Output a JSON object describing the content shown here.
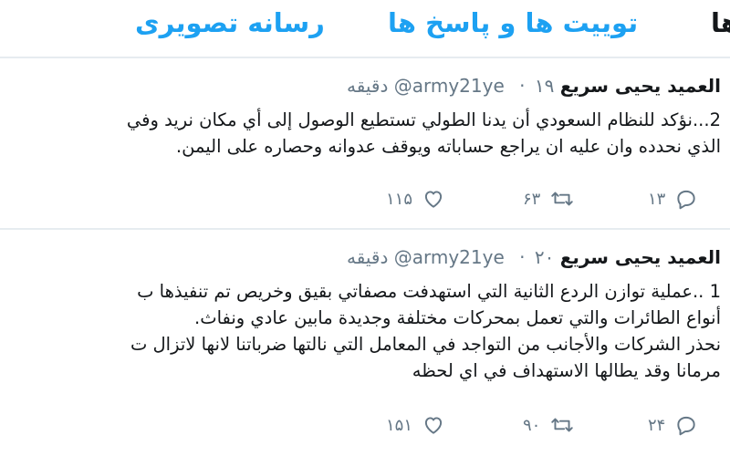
{
  "tabs": {
    "cut_label": "ها",
    "replies_label": "توییت ها و پاسخ ها",
    "media_label": "رسانه تصویری"
  },
  "tweets": [
    {
      "name": "العميد يحيى سريع",
      "handle": "@army21ye",
      "separator": "·",
      "time": "۱۹ دقیقه",
      "lines": [
        "2...نؤكد للنظام السعودي أن يدنا الطولي تستطيع الوصول إلى أي مكان نريد وفي",
        "الذي نحدده وان عليه ان يراجع حساباته ويوقف عدوانه وحصاره على اليمن."
      ],
      "reply_count": "۱۳",
      "retweet_count": "۶۳",
      "like_count": "۱۱۵"
    },
    {
      "name": "العميد يحيى سريع",
      "handle": "@army21ye",
      "separator": "·",
      "time": "۲۰ دقیقه",
      "lines": [
        "1 ..عملية توازن الردع الثانية التي استهدفت مصفاتي بقيق وخريص  تم تنفيذها ب",
        "أنواع الطائرات والتي تعمل بمحركات مختلفة وجديدة مابين عادي ونفاث.",
        "نحذر  الشركات والأجانب من التواجد في المعامل التي نالتها ضرباتنا لانها لاتزال ت",
        "مرمانا وقد يطالها الاستهداف في اي لحظه"
      ],
      "reply_count": "۲۴",
      "retweet_count": "۹۰",
      "like_count": "۱۵۱"
    }
  ]
}
